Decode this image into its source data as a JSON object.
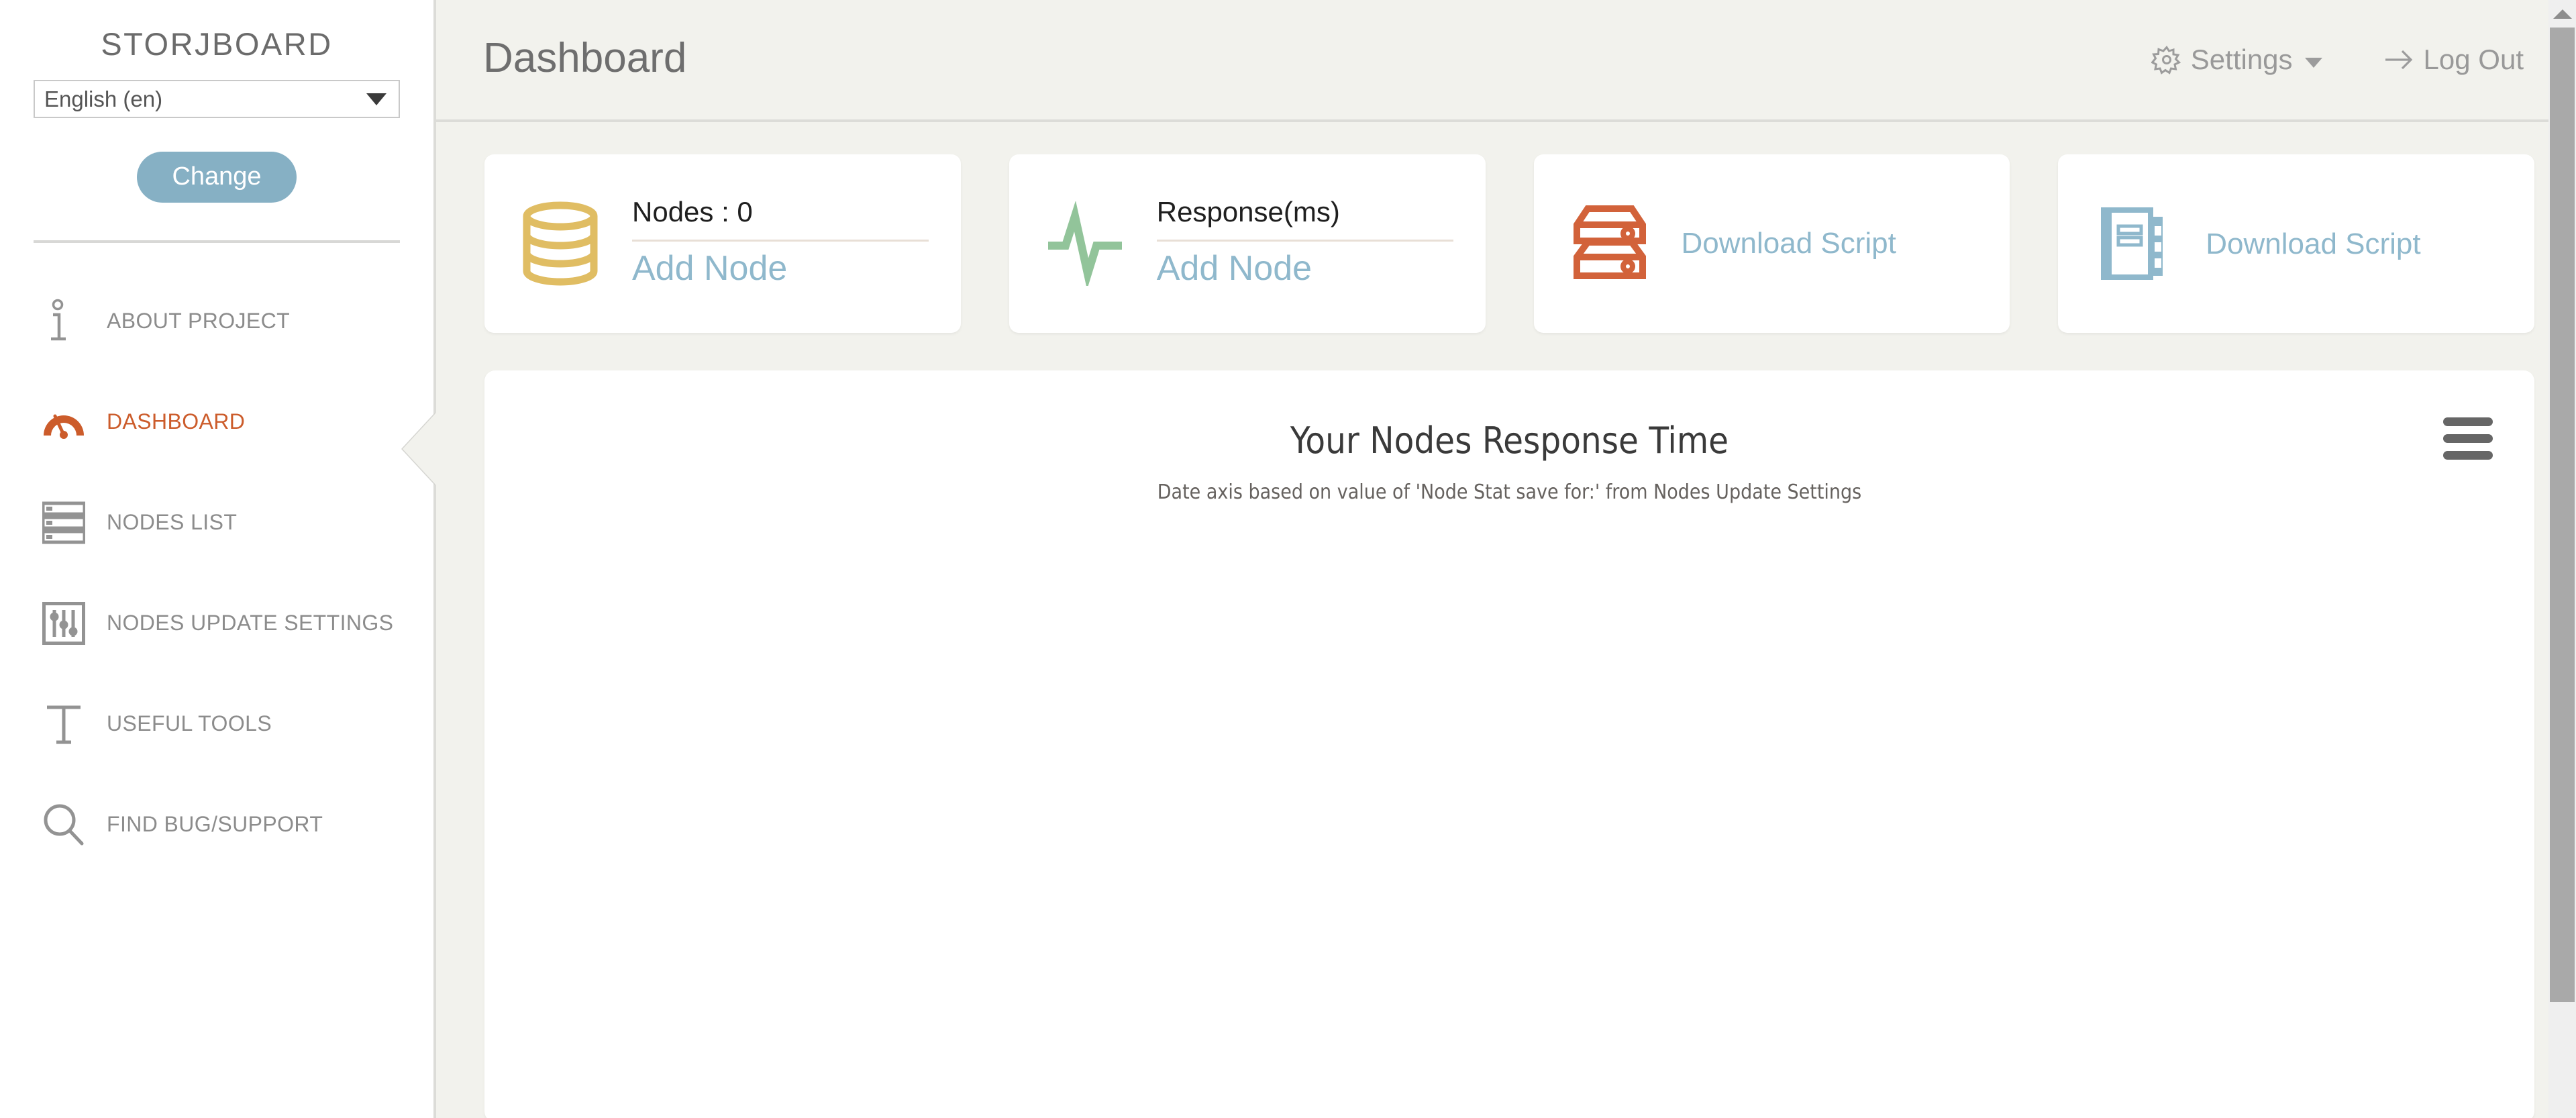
{
  "sidebar": {
    "brand": "STORJBOARD",
    "language": {
      "selected": "English (en)",
      "options": [
        "English (en)"
      ]
    },
    "change_button": "Change",
    "items": [
      {
        "label": "ABOUT PROJECT",
        "icon": "info-icon",
        "active": false
      },
      {
        "label": "DASHBOARD",
        "icon": "gauge-icon",
        "active": true
      },
      {
        "label": "NODES LIST",
        "icon": "list-icon",
        "active": false
      },
      {
        "label": "NODES UPDATE SETTINGS",
        "icon": "sliders-icon",
        "active": false
      },
      {
        "label": "USEFUL TOOLS",
        "icon": "text-tool-icon",
        "active": false
      },
      {
        "label": "FIND BUG/SUPPORT",
        "icon": "search-icon",
        "active": false
      }
    ]
  },
  "topbar": {
    "title": "Dashboard",
    "settings_label": "Settings",
    "settings_icon": "gear-icon",
    "logout_label": "Log Out",
    "logout_icon": "arrow-right-icon"
  },
  "cards": [
    {
      "id": "nodes-card",
      "icon": "database-stack-icon",
      "icon_color": "#e0bd63",
      "title": "Nodes : 0",
      "link": "Add Node",
      "has_rule": true,
      "layout": "titled"
    },
    {
      "id": "response-card",
      "icon": "pulse-icon",
      "icon_color": "#92c49a",
      "title": "Response(ms)",
      "link": "Add Node",
      "has_rule": true,
      "layout": "titled"
    },
    {
      "id": "download-script-server-card",
      "icon": "server-rack-icon",
      "icon_color": "#d2623a",
      "title": "",
      "link": "Download Script",
      "has_rule": false,
      "layout": "simple-two-line"
    },
    {
      "id": "download-script-doc-card",
      "icon": "document-panel-icon",
      "icon_color": "#8fb8cc",
      "title": "",
      "link": "Download Script",
      "has_rule": false,
      "layout": "simple"
    }
  ],
  "chart_data": {
    "type": "line",
    "title": "Your Nodes Response Time",
    "subtitle": "Date axis based on value of 'Node Stat save for:' from Nodes Update Settings",
    "menu_icon": "hamburger-menu-icon",
    "xlabel": "",
    "ylabel": "",
    "categories": [],
    "series": [],
    "legend": [],
    "grid": false,
    "empty": true
  },
  "scrollbar": {
    "up_arrow_icon": "triangle-up-icon",
    "thumb_position": "top"
  },
  "colors": {
    "accent_orange": "#cc5c2b",
    "accent_blue": "#8fb8cc",
    "page_bg": "#f2f2ed",
    "card_bg": "#ffffff",
    "muted_text": "#8c8c8c"
  }
}
